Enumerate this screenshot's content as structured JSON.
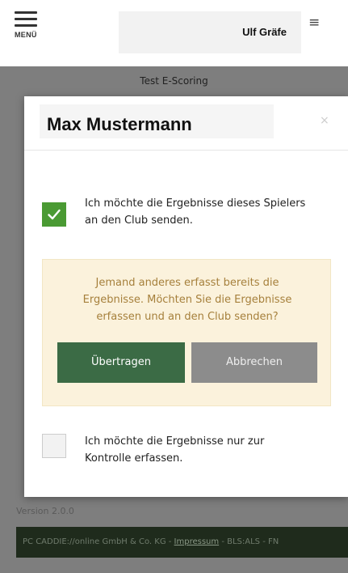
{
  "header": {
    "menu_label": "MENÜ",
    "user_name": "Ulf Gräfe",
    "user_menu_icon": "≡"
  },
  "page": {
    "subtitle": "Test E-Scoring",
    "version": "Version 2.0.0"
  },
  "footer": {
    "company": "PC CADDIE://online GmbH & Co. KG - ",
    "imprint_link": "Impressum",
    "suffix": " - BLS:ALS - FN"
  },
  "modal": {
    "title": "Max Mustermann",
    "close_icon": "×",
    "option_send": {
      "checked": true,
      "label_line1": "Ich möchte die Ergebnisse dieses Spielers",
      "label_line2": "an den Club senden."
    },
    "warning": {
      "line1": "Jemand anderes erfasst bereits die",
      "line2": "Ergebnisse. Möchten Sie die Ergebnisse",
      "line3": "erfassen und an den Club senden?",
      "confirm_label": "Übertragen",
      "cancel_label": "Abbrechen"
    },
    "option_control": {
      "checked": false,
      "label_line1": "Ich möchte die Ergebnisse nur zur",
      "label_line2": "Kontrolle erfassen."
    }
  },
  "colors": {
    "checkbox_checked": "#4a9a33",
    "primary_button": "#3b6b45",
    "cancel_button": "#8c8c8c",
    "warning_bg": "#fbf2dc",
    "warning_text": "#a6803c",
    "footer_bg": "#1f2b1c"
  }
}
